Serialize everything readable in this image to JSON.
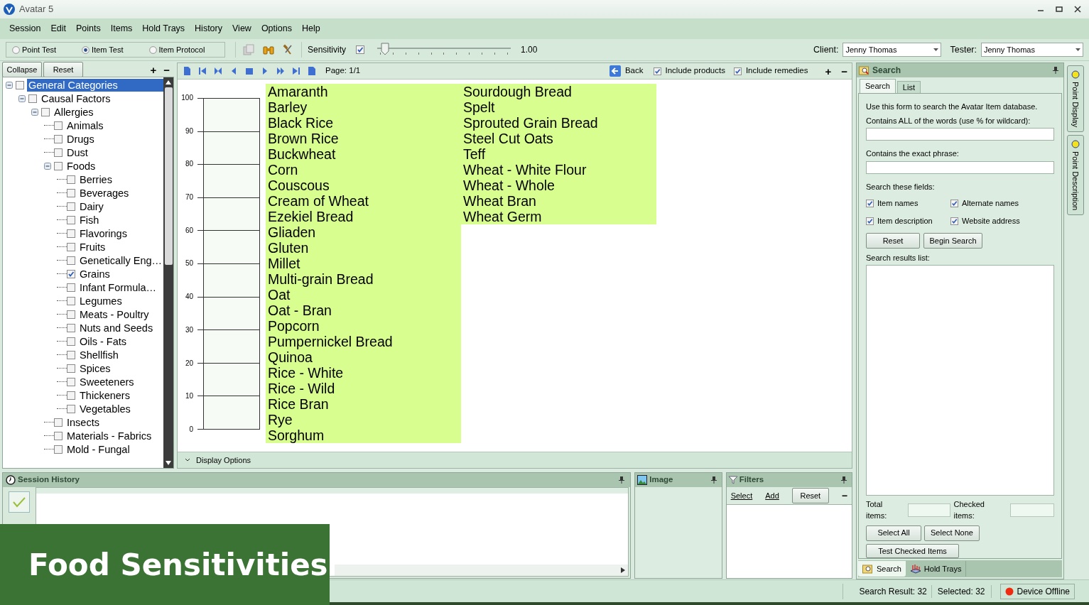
{
  "window": {
    "title": "Avatar 5"
  },
  "menu": [
    "Session",
    "Edit",
    "Points",
    "Items",
    "Hold Trays",
    "History",
    "View",
    "Options",
    "Help"
  ],
  "toolbar": {
    "modes": [
      {
        "label": "Point Test",
        "selected": false
      },
      {
        "label": "Item Test",
        "selected": true
      },
      {
        "label": "Item Protocol",
        "selected": false
      }
    ],
    "sensitivity": {
      "label": "Sensitivity",
      "checked": true,
      "level": 0.03,
      "reading": "1.00"
    },
    "client": {
      "label": "Client:",
      "value": "Jenny Thomas"
    },
    "tester": {
      "label": "Tester:",
      "value": "Jenny Thomas"
    }
  },
  "tree_panel": {
    "buttons": [
      "Collapse",
      "Reset"
    ],
    "plus": "+",
    "minus": "−",
    "tree": [
      {
        "label": "General Categories",
        "selected": true,
        "checked": false,
        "expanded": true,
        "children": [
          {
            "label": "Causal Factors",
            "selected": false,
            "checked": false,
            "expanded": true,
            "children": [
              {
                "label": "Allergies",
                "selected": false,
                "checked": false,
                "expanded": true,
                "children": [
                  {
                    "label": "Animals",
                    "selected": false,
                    "checked": false
                  },
                  {
                    "label": "Drugs",
                    "selected": false,
                    "checked": false
                  },
                  {
                    "label": "Dust",
                    "selected": false,
                    "checked": false
                  },
                  {
                    "label": "Foods",
                    "selected": false,
                    "checked": false,
                    "expanded": true,
                    "children": [
                      {
                        "label": "Berries",
                        "selected": false,
                        "checked": false
                      },
                      {
                        "label": "Beverages",
                        "selected": false,
                        "checked": false
                      },
                      {
                        "label": "Dairy",
                        "selected": false,
                        "checked": false
                      },
                      {
                        "label": "Fish",
                        "selected": false,
                        "checked": false
                      },
                      {
                        "label": "Flavorings",
                        "selected": false,
                        "checked": false
                      },
                      {
                        "label": "Fruits",
                        "selected": false,
                        "checked": false
                      },
                      {
                        "label": "Genetically Eng…",
                        "selected": false,
                        "checked": false
                      },
                      {
                        "label": "Grains",
                        "selected": false,
                        "checked": true
                      },
                      {
                        "label": "Infant Formula…",
                        "selected": false,
                        "checked": false
                      },
                      {
                        "label": "Legumes",
                        "selected": false,
                        "checked": false
                      },
                      {
                        "label": "Meats - Poultry",
                        "selected": false,
                        "checked": false
                      },
                      {
                        "label": "Nuts and Seeds",
                        "selected": false,
                        "checked": false
                      },
                      {
                        "label": "Oils - Fats",
                        "selected": false,
                        "checked": false
                      },
                      {
                        "label": "Shellfish",
                        "selected": false,
                        "checked": false
                      },
                      {
                        "label": "Spices",
                        "selected": false,
                        "checked": false
                      },
                      {
                        "label": "Sweeteners",
                        "selected": false,
                        "checked": false
                      },
                      {
                        "label": "Thickeners",
                        "selected": false,
                        "checked": false
                      },
                      {
                        "label": "Vegetables",
                        "selected": false,
                        "checked": false
                      }
                    ]
                  },
                  {
                    "label": "Insects",
                    "selected": false,
                    "checked": false
                  },
                  {
                    "label": "Materials - Fabrics",
                    "selected": false,
                    "checked": false
                  },
                  {
                    "label": "Mold - Fungal",
                    "selected": false,
                    "checked": false
                  }
                ]
              }
            ]
          }
        ]
      }
    ]
  },
  "item_nav": {
    "page": "Page: 1/1",
    "back": "Back",
    "include_products": {
      "label": "Include products",
      "checked": true
    },
    "include_remedies": {
      "label": "Include remedies",
      "checked": true
    },
    "plus": "+",
    "minus": "−"
  },
  "meter": {
    "scale": [
      "100",
      "90",
      "80",
      "70",
      "60",
      "50",
      "40",
      "30",
      "20",
      "10",
      "0"
    ]
  },
  "items": [
    {
      "label": "Amaranth",
      "selected": true
    },
    {
      "label": "Barley",
      "selected": true
    },
    {
      "label": "Black Rice",
      "selected": true
    },
    {
      "label": "Brown Rice",
      "selected": true
    },
    {
      "label": "Buckwheat",
      "selected": true
    },
    {
      "label": "Corn",
      "selected": true
    },
    {
      "label": "Couscous",
      "selected": true
    },
    {
      "label": "Cream of Wheat",
      "selected": true
    },
    {
      "label": "Ezekiel Bread",
      "selected": true
    },
    {
      "label": "Gliaden",
      "selected": true
    },
    {
      "label": "Gluten",
      "selected": true
    },
    {
      "label": "Millet",
      "selected": true
    },
    {
      "label": "Multi-grain Bread",
      "selected": true
    },
    {
      "label": "Oat",
      "selected": true
    },
    {
      "label": "Oat - Bran",
      "selected": true
    },
    {
      "label": "Popcorn",
      "selected": true
    },
    {
      "label": "Pumpernickel Bread",
      "selected": true
    },
    {
      "label": "Quinoa",
      "selected": true
    },
    {
      "label": "Rice - White",
      "selected": true
    },
    {
      "label": "Rice - Wild",
      "selected": true
    },
    {
      "label": "Rice Bran",
      "selected": true
    },
    {
      "label": "Rye",
      "selected": true
    },
    {
      "label": "Sorghum",
      "selected": true
    },
    {
      "label": "Sourdough Bread",
      "selected": true
    },
    {
      "label": "Spelt",
      "selected": true
    },
    {
      "label": "Sprouted Grain Bread",
      "selected": true
    },
    {
      "label": "Steel Cut Oats",
      "selected": true
    },
    {
      "label": "Teff",
      "selected": true
    },
    {
      "label": "Wheat - White Flour",
      "selected": true
    },
    {
      "label": "Wheat - Whole",
      "selected": true
    },
    {
      "label": "Wheat Bran",
      "selected": true
    },
    {
      "label": "Wheat Germ",
      "selected": true
    }
  ],
  "display_options": "Display Options",
  "search_panel": {
    "title": "Search",
    "tabs": [
      {
        "label": "Search",
        "selected": true
      },
      {
        "label": "List",
        "selected": false
      }
    ],
    "intro": "Use this form to search the Avatar Item database.",
    "all_words_label": "Contains ALL of the words (use % for wildcard):",
    "exact_label": "Contains the exact phrase:",
    "fields_label": "Search these fields:",
    "fields": [
      {
        "label": "Item names",
        "checked": true
      },
      {
        "label": "Alternate names",
        "checked": true
      },
      {
        "label": "Item description",
        "checked": true
      },
      {
        "label": "Website address",
        "checked": true
      }
    ],
    "buttons": [
      "Reset",
      "Begin Search"
    ],
    "results_label": "Search results list:",
    "total_label": "Total items:",
    "checked_label": "Checked items:",
    "select_buttons": [
      "Select All",
      "Select None"
    ],
    "test_button": "Test Checked Items",
    "bottom_tabs": [
      {
        "label": "Search",
        "selected": true
      },
      {
        "label": "Hold Trays",
        "selected": false
      }
    ]
  },
  "side_tabs": [
    "Point Display",
    "Point Description"
  ],
  "session_history": {
    "title": "Session History"
  },
  "image_panel": {
    "title": "Image"
  },
  "filters": {
    "title": "Filters",
    "links": [
      "Select",
      "Add"
    ],
    "reset": "Reset",
    "minus": "−"
  },
  "status_bar": {
    "search_result": "Search Result: 32",
    "selected": "Selected: 32",
    "device": {
      "label": "Device Offline",
      "online": false
    }
  },
  "banner": "Food Sensitivities"
}
